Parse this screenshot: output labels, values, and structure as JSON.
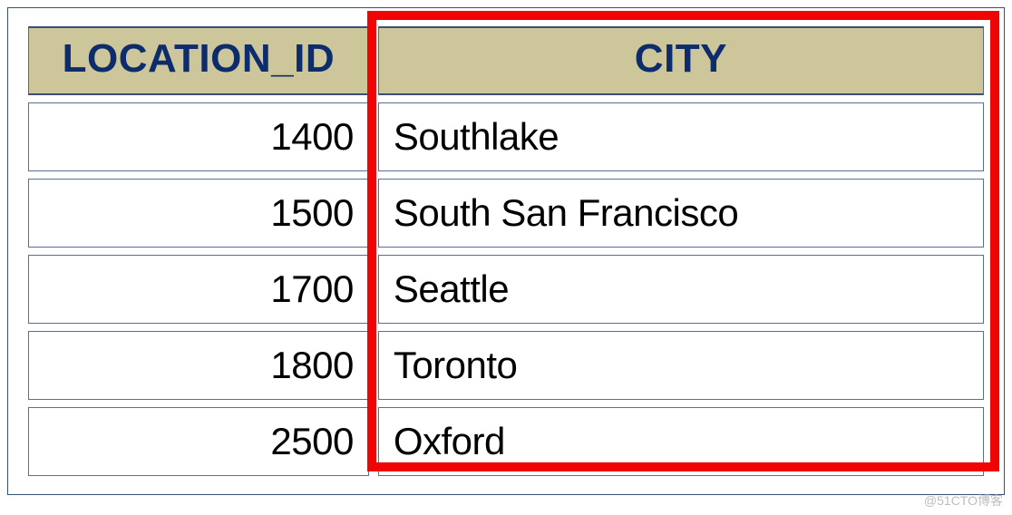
{
  "table": {
    "headers": {
      "location_id": "LOCATION_ID",
      "city": "CITY"
    },
    "rows": [
      {
        "location_id": "1400",
        "city": "Southlake"
      },
      {
        "location_id": "1500",
        "city": "South San Francisco"
      },
      {
        "location_id": "1700",
        "city": "Seattle"
      },
      {
        "location_id": "1800",
        "city": "Toronto"
      },
      {
        "location_id": "2500",
        "city": "Oxford"
      }
    ]
  },
  "highlight": {
    "column": "city"
  },
  "watermark": "@51CTO博客",
  "chart_data": {
    "type": "table",
    "columns": [
      "LOCATION_ID",
      "CITY"
    ],
    "rows": [
      [
        1400,
        "Southlake"
      ],
      [
        1500,
        "South San Francisco"
      ],
      [
        1700,
        "Seattle"
      ],
      [
        1800,
        "Toronto"
      ],
      [
        2500,
        "Oxford"
      ]
    ]
  }
}
